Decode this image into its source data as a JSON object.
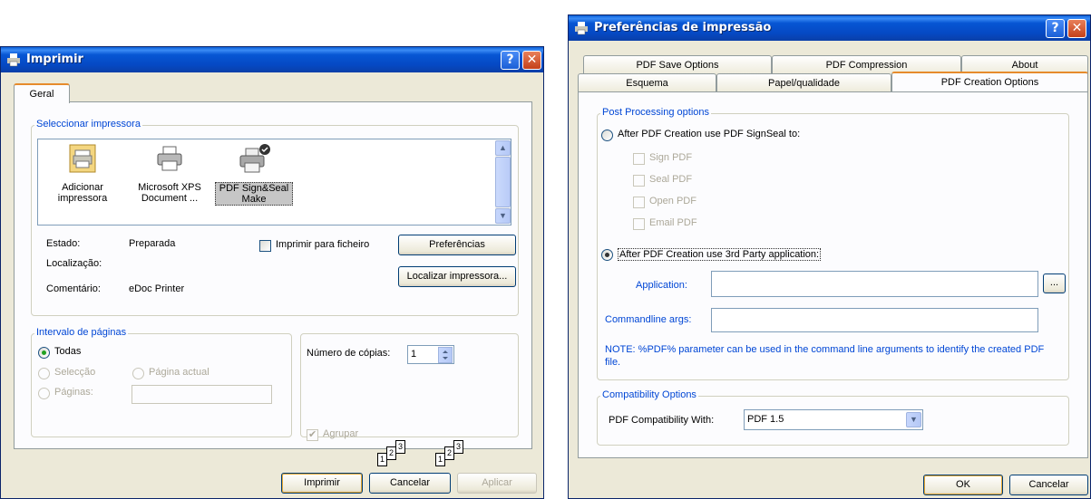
{
  "print_dialog": {
    "title": "Imprimir",
    "help": "?",
    "close": "✕",
    "tab": "Geral",
    "select_printer_label": "Seleccionar impressora",
    "printers": [
      {
        "name_line1": "Adicionar",
        "name_line2": "impressora"
      },
      {
        "name_line1": "Microsoft XPS",
        "name_line2": "Document ..."
      },
      {
        "name_line1": "PDF Sign&Seal",
        "name_line2": "Make"
      }
    ],
    "status_label": "Estado:",
    "status_value": "Preparada",
    "location_label": "Localização:",
    "comment_label": "Comentário:",
    "comment_value": "eDoc Printer",
    "print_to_file": "Imprimir para ficheiro",
    "preferences_button": "Preferências",
    "find_printer_button": "Localizar impressora...",
    "page_range_label": "Intervalo de páginas",
    "range_all": "Todas",
    "range_selection": "Selecção",
    "range_current": "Página actual",
    "range_pages": "Páginas:",
    "copies_label": "Número de cópias:",
    "copies_value": "1",
    "collate": "Agrupar",
    "collate_pages": [
      "1",
      "2",
      "3"
    ],
    "print_button": "Imprimir",
    "cancel_button": "Cancelar",
    "apply_button": "Aplicar"
  },
  "prefs_dialog": {
    "title": "Preferências de impressão",
    "help": "?",
    "close": "✕",
    "tabs_row1": [
      "PDF Save Options",
      "PDF Compression",
      "About"
    ],
    "tabs_row2": [
      "Esquema",
      "Papel/qualidade",
      "PDF Creation Options"
    ],
    "post_processing_label": "Post Processing options",
    "opt_signseal": "After PDF Creation use PDF SignSeal to:",
    "sub_options": [
      "Sign PDF",
      "Seal PDF",
      "Open PDF",
      "Email PDF"
    ],
    "opt_3rdparty": "After PDF Creation use 3rd Party application:",
    "application_label": "Application:",
    "application_value": "",
    "browse_button": "...",
    "cmdline_label": "Commandline args:",
    "cmdline_value": "",
    "note": "NOTE: %PDF% parameter can be used in the command line arguments to identify the created PDF file.",
    "compat_group_label": "Compatibility Options",
    "compat_label": "PDF Compatibility With:",
    "compat_value": "PDF 1.5",
    "ok_button": "OK",
    "cancel_button": "Cancelar"
  },
  "colors": {
    "titlebar": "#0549c4",
    "dialog_bg": "#ece9d8",
    "group_label": "#0046d5",
    "check_green": "#21a121"
  }
}
